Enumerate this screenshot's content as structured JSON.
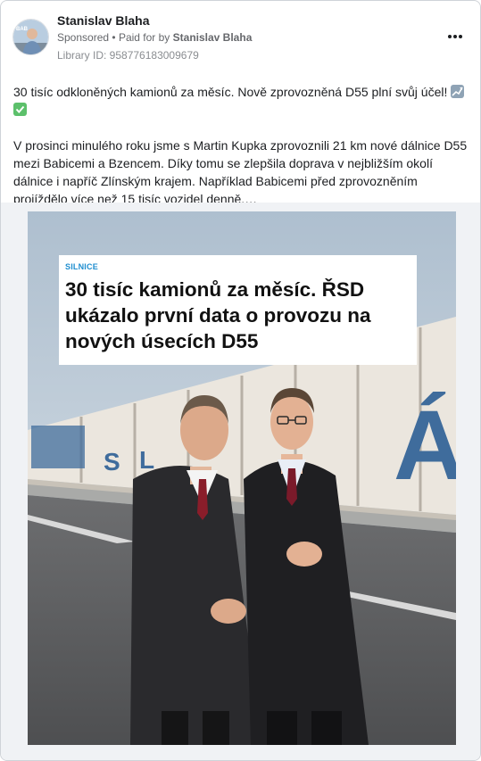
{
  "post": {
    "author": "Stanislav Blaha",
    "sponsored_label": "Sponsored",
    "paid_for_prefix": "Paid for by",
    "paid_for_by": "Stanislav Blaha",
    "library_id": "Library ID: 958776183009679",
    "paragraph1": "30 tisíc odkloněných kamionů za měsíc. Nově zprovozněná D55 plní svůj účel!",
    "paragraph2": "V prosinci minulého roku jsme s Martin Kupka zprovoznili 21 km nové dálnice D55 mezi Babicemi a Bzencem. Díky tomu se zlepšila doprava v nejbližším okolí dálnice i napříč Zlínským krajem. Například Babicemi před zprovozněním projíždělo více než 15 tisíc vozidel denně.…",
    "emoji_icons": [
      "chart-up-emoji-icon",
      "check-mark-emoji-icon"
    ]
  },
  "media": {
    "category": "SILNICE",
    "headline": "30 tisíc kamionů za měsíc. ŘSD ukázalo první data o provozu na nových úsecích D55",
    "wall_lettering": "S L Á"
  },
  "colors": {
    "category_blue": "#1f8ecf",
    "sky": "#c6d3de",
    "wall": "#e9e4dc",
    "coat": "#2b2b2e"
  }
}
